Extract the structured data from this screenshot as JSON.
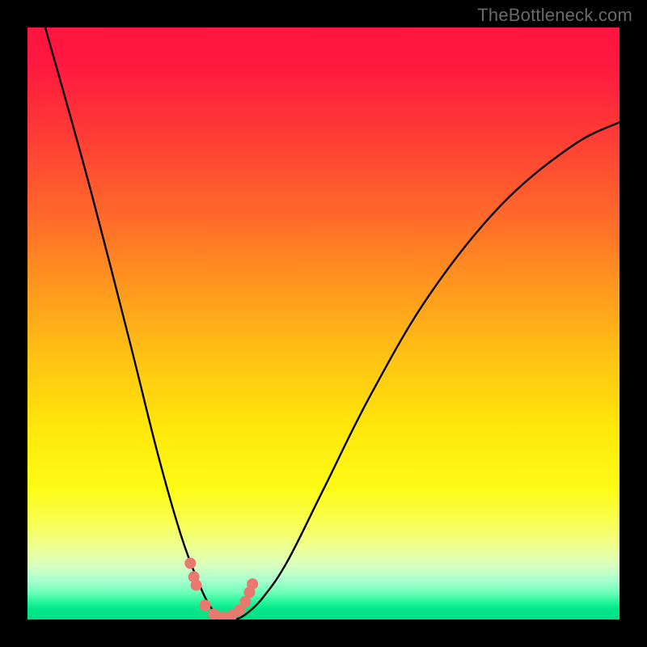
{
  "attribution": "TheBottleneck.com",
  "chart_data": {
    "type": "line",
    "title": "",
    "xlabel": "",
    "ylabel": "",
    "xlim": [
      0,
      100
    ],
    "ylim": [
      0,
      100
    ],
    "series": [
      {
        "name": "bottleneck-curve",
        "x": [
          3,
          10,
          17,
          22,
          26,
          29,
          31,
          33,
          35,
          37,
          40,
          44,
          50,
          58,
          68,
          80,
          92,
          100
        ],
        "values": [
          100,
          75,
          48,
          28,
          14,
          6,
          2,
          0,
          0,
          1,
          4,
          10,
          22,
          38,
          55,
          70,
          80,
          84
        ]
      }
    ],
    "markers": {
      "name": "highlighted-points",
      "x": [
        27.5,
        28.1,
        28.5,
        30.0,
        31.5,
        33.0,
        34.5,
        35.8,
        36.8,
        37.5,
        38.0
      ],
      "values": [
        9.5,
        7.2,
        5.8,
        2.4,
        0.9,
        0.4,
        0.7,
        1.6,
        3.0,
        4.6,
        6.0
      ],
      "color": "#e9786f",
      "size": 14
    },
    "gradient_meaning": "top (red) = high bottleneck, bottom (green) = low bottleneck"
  }
}
